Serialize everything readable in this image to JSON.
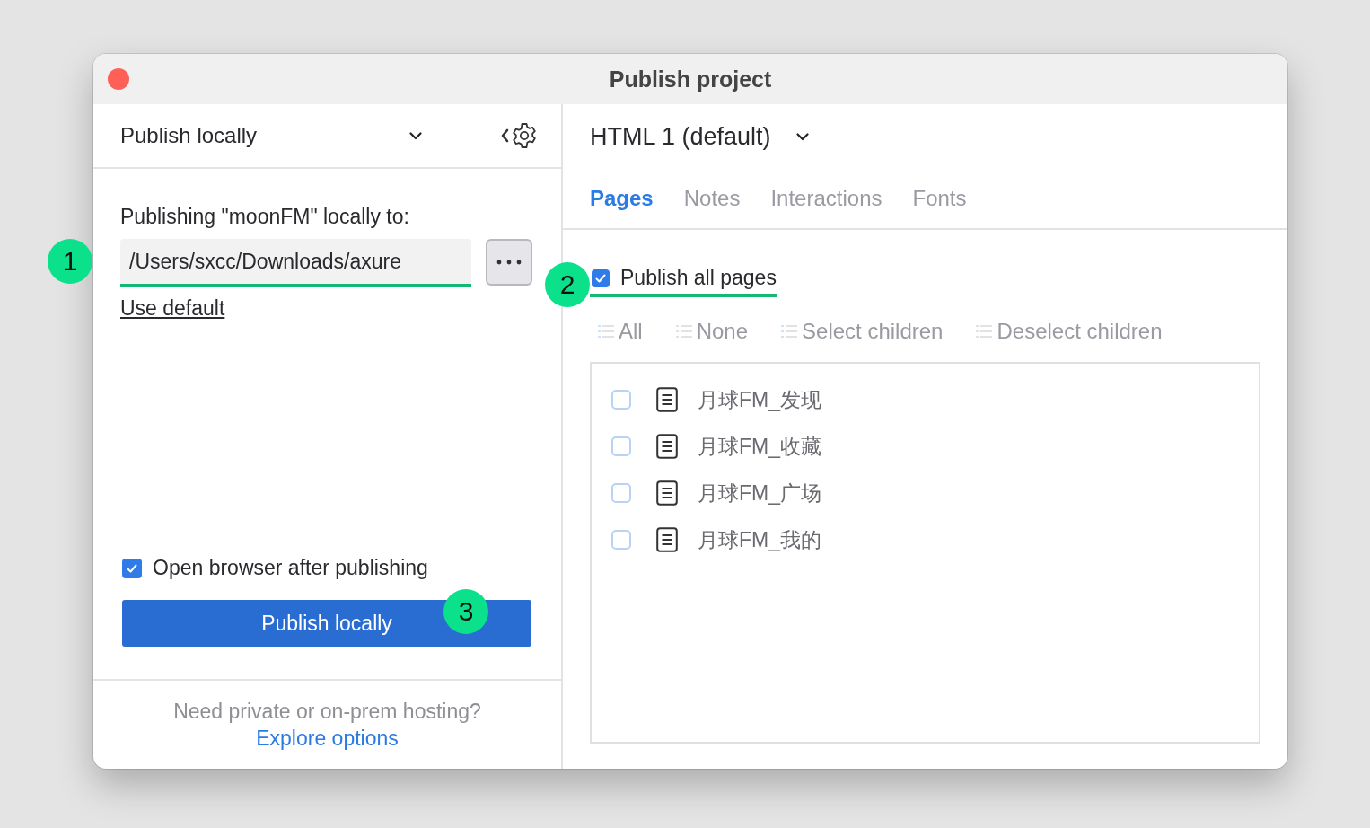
{
  "window": {
    "title": "Publish project"
  },
  "left": {
    "mode": "Publish locally",
    "label": "Publishing \"moonFM\" locally to:",
    "path": "/Users/sxcc/Downloads/axure",
    "use_default": "Use default",
    "open_browser": {
      "label": "Open browser after publishing",
      "checked": true
    },
    "publish_button": "Publish locally",
    "footer_text": "Need private or on-prem hosting?",
    "footer_link": "Explore options"
  },
  "right": {
    "format": "HTML 1 (default)",
    "tabs": [
      {
        "label": "Pages",
        "selected": true
      },
      {
        "label": "Notes",
        "selected": false
      },
      {
        "label": "Interactions",
        "selected": false
      },
      {
        "label": "Fonts",
        "selected": false
      }
    ],
    "publish_all": {
      "label": "Publish all pages",
      "checked": true
    },
    "actions": [
      "All",
      "None",
      "Select children",
      "Deselect children"
    ],
    "pages": [
      {
        "name": "月球FM_发现",
        "checked": false
      },
      {
        "name": "月球FM_收藏",
        "checked": false
      },
      {
        "name": "月球FM_广场",
        "checked": false
      },
      {
        "name": "月球FM_我的",
        "checked": false
      }
    ]
  },
  "annotations": [
    "1",
    "2",
    "3"
  ]
}
